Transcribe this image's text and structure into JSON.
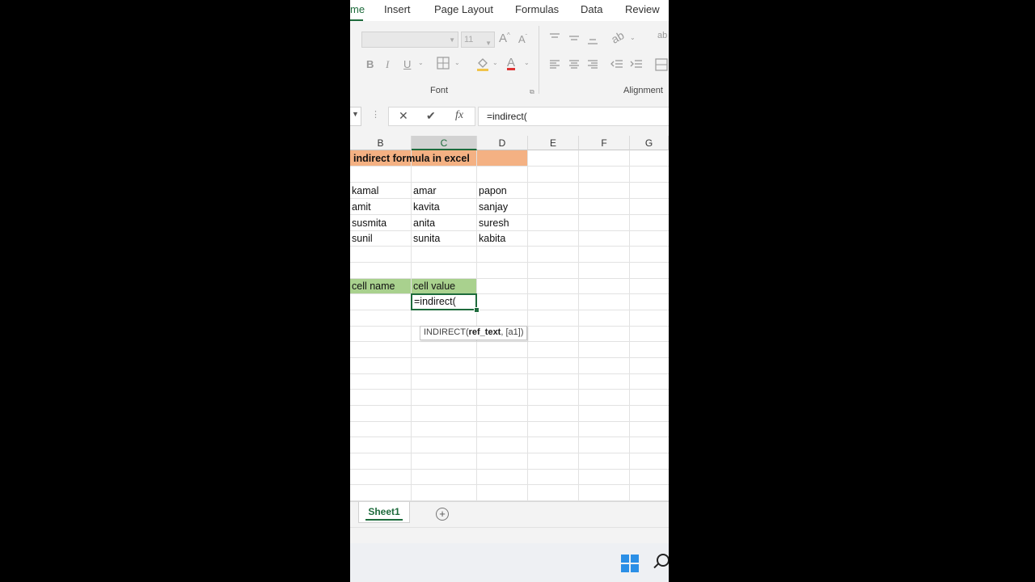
{
  "ribbon": {
    "tabs": [
      {
        "label": "me",
        "active": true
      },
      {
        "label": "Insert"
      },
      {
        "label": "Page Layout"
      },
      {
        "label": "Formulas"
      },
      {
        "label": "Data"
      },
      {
        "label": "Review"
      }
    ],
    "font_size": "11",
    "groups": {
      "font": "Font",
      "alignment": "Alignment"
    },
    "buttons": {
      "bold": "B",
      "italic": "I",
      "underline": "U",
      "grow": "A",
      "shrink": "A",
      "font_color": "A",
      "wrap": "ab"
    }
  },
  "formula_bar": {
    "cancel": "✕",
    "enter": "✔",
    "fx": "fx",
    "value": "=indirect("
  },
  "grid": {
    "columns": [
      "B",
      "C",
      "D",
      "E",
      "F",
      "G"
    ],
    "selected_column": "C",
    "title": "indirect formula in excel",
    "names": [
      [
        "kamal",
        "amar",
        "papon"
      ],
      [
        "amit",
        "kavita",
        "sanjay"
      ],
      [
        "susmita",
        "anita",
        "suresh"
      ],
      [
        "sunil",
        "sunita",
        "kabita"
      ]
    ],
    "header_b": "cell name",
    "header_c": "cell value",
    "active_cell_text": "=indirect(",
    "tooltip": {
      "func": "INDIRECT(",
      "arg_bold": "ref_text",
      "rest": ", [a1])"
    }
  },
  "sheets": {
    "tabs": [
      "Sheet1"
    ],
    "add": "+"
  },
  "colors": {
    "accent": "#1e6b3c",
    "title_fill": "#f4b183",
    "header_fill": "#a9d18e"
  }
}
